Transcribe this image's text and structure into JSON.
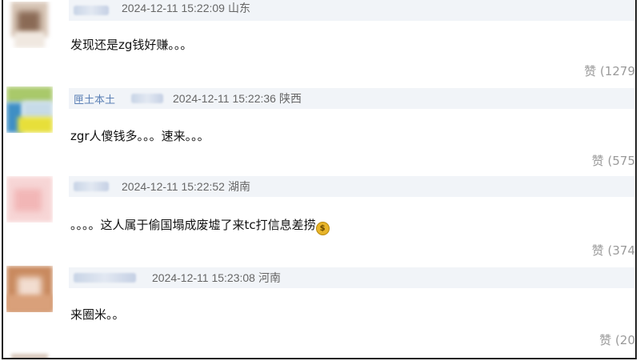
{
  "comments": [
    {
      "timestamp": "2024-12-11 15:22:09",
      "location": "山东",
      "text": "发现还是zg钱好赚。。。",
      "likes": "赞 (1279"
    },
    {
      "name_fragment": "匣土本土",
      "timestamp": "2024-12-11 15:22:36",
      "location": "陕西",
      "text": "zgr人傻钱多。。。速来。。。",
      "likes": "赞 (575"
    },
    {
      "timestamp": "2024-12-11 15:22:52",
      "location": "湖南",
      "text": "。。。。这人属于偷国塌成废墟了来tc打信息差捞",
      "likes": "赞 (374"
    },
    {
      "timestamp": "2024-12-11 15:23:08",
      "location": "河南",
      "text": "来圈米。。",
      "likes": "赞 (20"
    }
  ],
  "icons": {
    "money_bag": "money-bag-icon"
  },
  "colors": {
    "meta_bar": "#f1f4f8",
    "like_text": "#9a9a9a",
    "meta_text": "#666666"
  }
}
